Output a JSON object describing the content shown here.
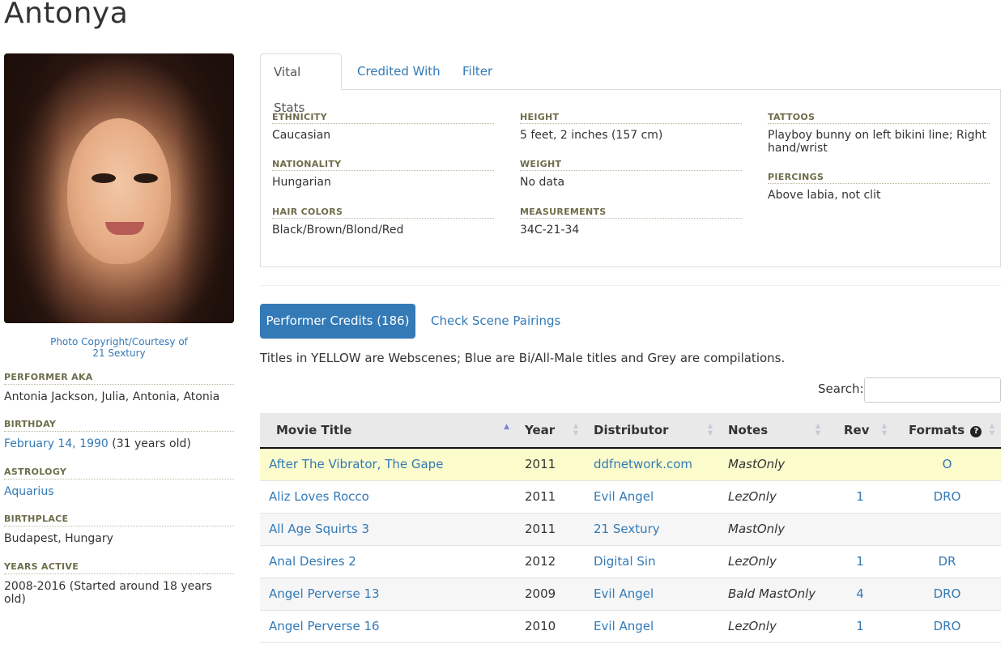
{
  "page": {
    "title": "Antonya"
  },
  "photo": {
    "credit_line1": "Photo Copyright/Courtesy of",
    "credit_line2": "21 Sextury"
  },
  "bio": [
    {
      "label": "PERFORMER AKA",
      "value": "Antonia Jackson, Julia, Antonia, Atonia"
    },
    {
      "label": "BIRTHDAY",
      "value_link": "February 14, 1990",
      "value_extra": " (31 years old)"
    },
    {
      "label": "ASTROLOGY",
      "value_link": "Aquarius"
    },
    {
      "label": "BIRTHPLACE",
      "value": "Budapest, Hungary"
    },
    {
      "label": "YEARS ACTIVE",
      "value": "2008-2016 (Started around 18 years old)"
    }
  ],
  "tabs": [
    "Vital Stats",
    "Credited With",
    "Filter"
  ],
  "vital_stats": {
    "ethnicity": {
      "label": "ETHNICITY",
      "value": "Caucasian"
    },
    "nationality": {
      "label": "NATIONALITY",
      "value": "Hungarian"
    },
    "hair_colors": {
      "label": "HAIR COLORS",
      "value": "Black/Brown/Blond/Red"
    },
    "height": {
      "label": "HEIGHT",
      "value": "5 feet, 2 inches (157 cm)"
    },
    "weight": {
      "label": "WEIGHT",
      "value": "No data"
    },
    "measurements": {
      "label": "MEASUREMENTS",
      "value": "34C-21-34"
    },
    "tattoos": {
      "label": "TATTOOS",
      "value": "Playboy bunny on left bikini line; Right hand/wrist"
    },
    "piercings": {
      "label": "PIERCINGS",
      "value": "Above labia, not clit"
    }
  },
  "credits": {
    "performer_credits_button": "Performer Credits (186)",
    "scene_pairings_link": "Check Scene Pairings",
    "legend_note": "Titles in YELLOW are Webscenes; Blue are Bi/All-Male titles and Grey are compilations.",
    "search_label": "Search:",
    "search_value": "",
    "columns": {
      "title": "Movie Title",
      "year": "Year",
      "distributor": "Distributor",
      "notes": "Notes",
      "rev": "Rev",
      "formats": "Formats"
    },
    "rows": [
      {
        "title": "After The Vibrator, The Gape",
        "year": "2011",
        "distributor": "ddfnetwork.com",
        "notes": "MastOnly",
        "rev": "",
        "formats": "O"
      },
      {
        "title": "Aliz Loves Rocco",
        "year": "2011",
        "distributor": "Evil Angel",
        "notes": "LezOnly",
        "rev": "1",
        "formats": "DRO"
      },
      {
        "title": "All Age Squirts 3",
        "year": "2011",
        "distributor": "21 Sextury",
        "notes": "MastOnly",
        "rev": "",
        "formats": ""
      },
      {
        "title": "Anal Desires 2",
        "year": "2012",
        "distributor": "Digital Sin",
        "notes": "LezOnly",
        "rev": "1",
        "formats": "DR"
      },
      {
        "title": "Angel Perverse 13",
        "year": "2009",
        "distributor": "Evil Angel",
        "notes": "Bald MastOnly",
        "rev": "4",
        "formats": "DRO"
      },
      {
        "title": "Angel Perverse 16",
        "year": "2010",
        "distributor": "Evil Angel",
        "notes": "LezOnly",
        "rev": "1",
        "formats": "DRO"
      }
    ]
  }
}
